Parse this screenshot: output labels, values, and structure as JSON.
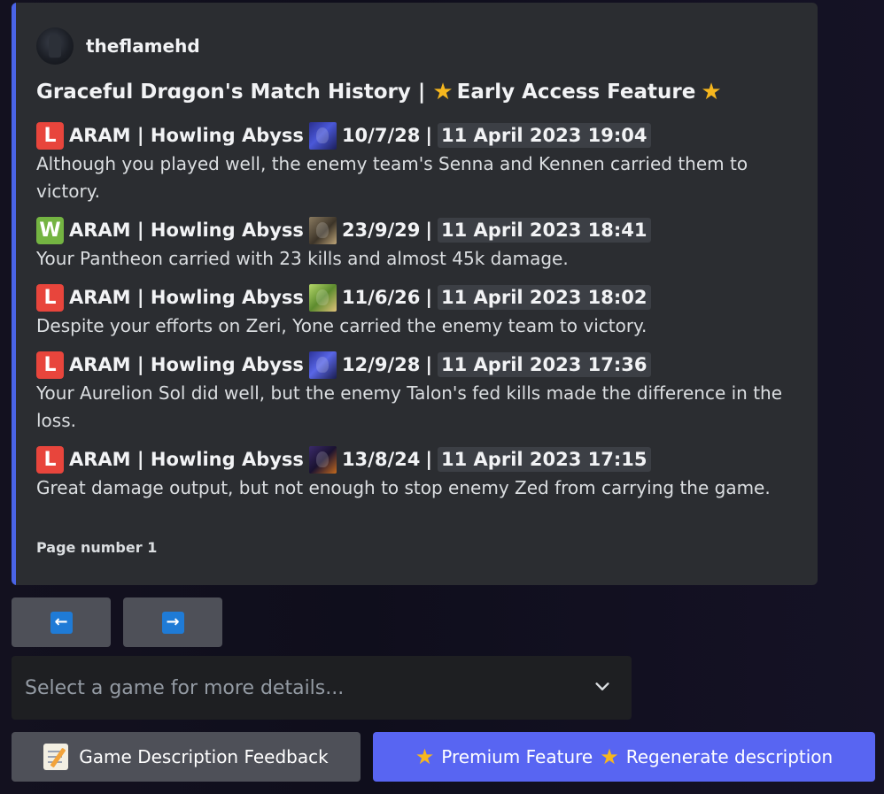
{
  "embed": {
    "author_name": "theflamehd",
    "title_main": "Graceful Drɑgon's Match History |",
    "title_feature": "Early Access Feature",
    "accent_color": "#4a64e6",
    "footer": "Page number 1",
    "games": [
      {
        "result": "L",
        "mode": "ARAM | Howling Abyss",
        "champion_icon": "kennen-icon",
        "kda": "10/7/28",
        "timestamp": "11 April 2023 19:04",
        "description": "Although you played well, the enemy team's Senna and Kennen carried them to victory."
      },
      {
        "result": "W",
        "mode": "ARAM | Howling Abyss",
        "champion_icon": "pantheon-icon",
        "kda": "23/9/29",
        "timestamp": "11 April 2023 18:41",
        "description": "Your Pantheon carried with 23 kills and almost 45k damage."
      },
      {
        "result": "L",
        "mode": "ARAM | Howling Abyss",
        "champion_icon": "zeri-icon",
        "kda": "11/6/26",
        "timestamp": "11 April 2023 18:02",
        "description": "Despite your efforts on Zeri, Yone carried the enemy team to victory."
      },
      {
        "result": "L",
        "mode": "ARAM | Howling Abyss",
        "champion_icon": "aurelion-sol-icon",
        "kda": "12/9/28",
        "timestamp": "11 April 2023 17:36",
        "description": "Your Aurelion Sol did well, but the enemy Talon's fed kills made the difference in the loss."
      },
      {
        "result": "L",
        "mode": "ARAM | Howling Abyss",
        "champion_icon": "zed-icon",
        "kda": "13/8/24",
        "timestamp": "11 April 2023 17:15",
        "description": "Great damage output, but not enough to stop enemy Zed from carrying the game."
      }
    ]
  },
  "buttons": {
    "prev_glyph": "←",
    "next_glyph": "→",
    "feedback_label": "Game Description Feedback",
    "premium_label": "Premium Feature",
    "regenerate_label": "Regenerate description"
  },
  "select": {
    "placeholder": "Select a game for more details..."
  },
  "colors": {
    "loss": "#e8453c",
    "win": "#74b442",
    "blurple": "#5865f2",
    "grey_button": "#4e5058"
  }
}
